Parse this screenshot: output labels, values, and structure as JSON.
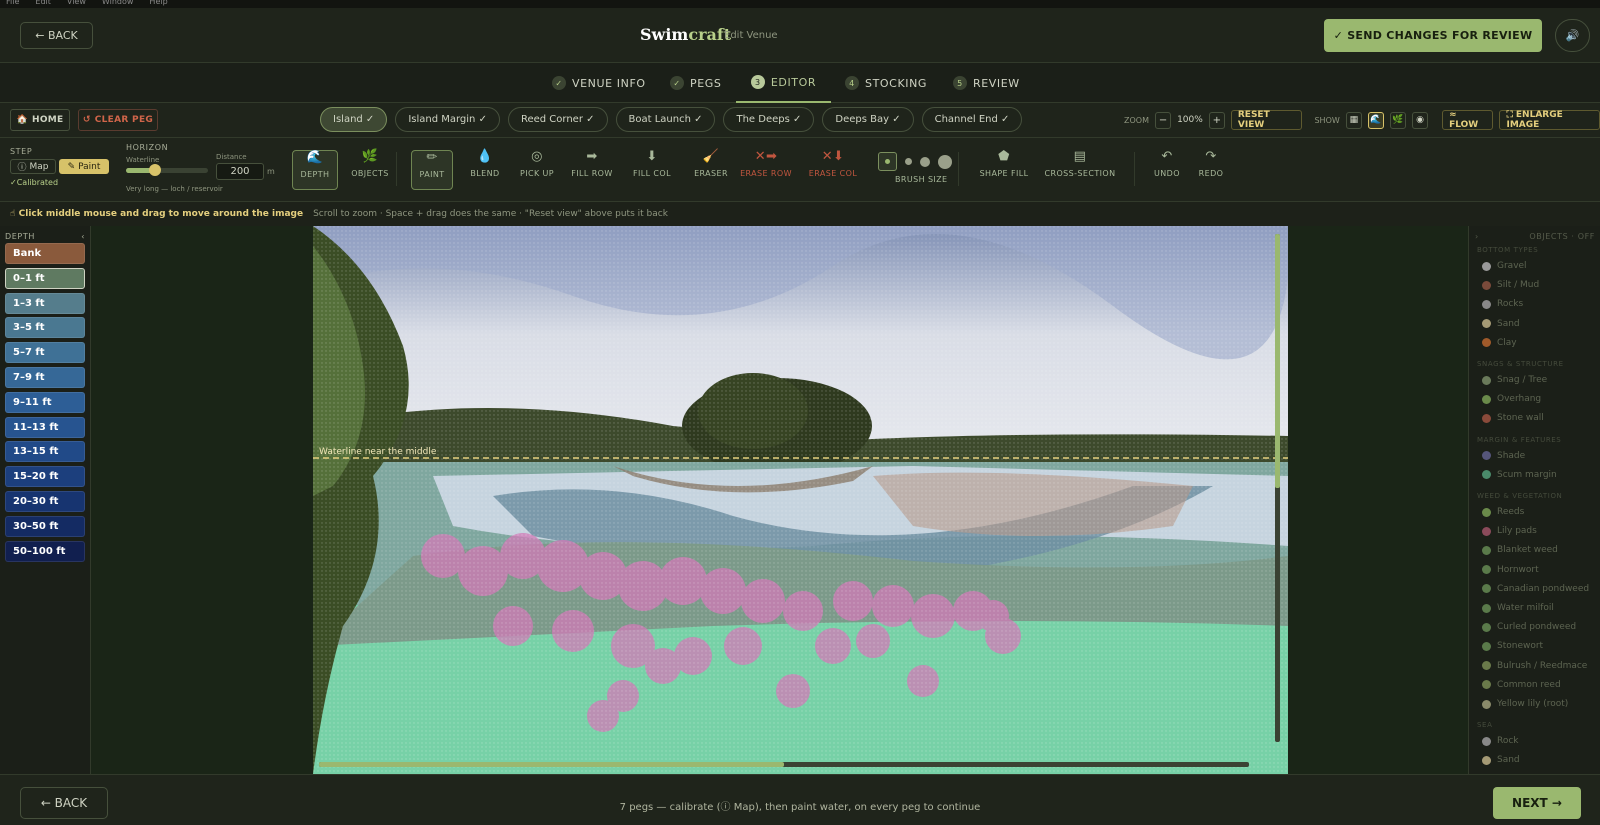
{
  "os_menu": [
    "File",
    "Edit",
    "View",
    "Window",
    "Help"
  ],
  "header": {
    "back_label": "← BACK",
    "brand_swim": "Swim",
    "brand_craft": "craft",
    "subtitle": "Edit Venue",
    "send_label": "✓ SEND CHANGES FOR REVIEW"
  },
  "steps": [
    {
      "num": "✓",
      "label": "VENUE INFO"
    },
    {
      "num": "✓",
      "label": "PEGS"
    },
    {
      "num": "3",
      "label": "EDITOR"
    },
    {
      "num": "4",
      "label": "STOCKING"
    },
    {
      "num": "5",
      "label": "REVIEW"
    }
  ],
  "pegbar": {
    "home_label": "HOME",
    "clear_label": "CLEAR PEG",
    "pegs": [
      "Island ✓",
      "Island Margin ✓",
      "Reed Corner ✓",
      "Boat Launch ✓",
      "The Deeps ✓",
      "Deeps Bay ✓",
      "Channel End ✓"
    ],
    "zoom_label": "ZOOM",
    "zoom_minus": "−",
    "zoom_value": "100%",
    "zoom_plus": "+",
    "reset_view": "RESET VIEW",
    "show_label": "SHOW",
    "flow_label": "≈ FLOW",
    "enlarge_label": "⛶ ENLARGE IMAGE"
  },
  "toolbar": {
    "step_label": "STEP",
    "map_label": "Map",
    "paint_label": "Paint",
    "calibrated": "✓Calibrated",
    "horizon_label": "HORIZON",
    "waterline_label": "Waterline",
    "distance_label": "Distance",
    "distance_value": "200",
    "distance_unit": "m",
    "waterline_level": 0.35,
    "horizon_note": "Very long — loch / reservoir",
    "tools": [
      {
        "icon": "🌊",
        "label": "DEPTH"
      },
      {
        "icon": "🌿",
        "label": "OBJECTS"
      },
      {
        "icon": "✏",
        "label": "PAINT"
      },
      {
        "icon": "💧",
        "label": "BLEND"
      },
      {
        "icon": "◎",
        "label": "PICK UP"
      },
      {
        "icon": "➡",
        "label": "FILL ROW"
      },
      {
        "icon": "⬇",
        "label": "FILL COL"
      },
      {
        "icon": "🧹",
        "label": "ERASER"
      },
      {
        "icon": "✕➡",
        "label": "ERASE ROW"
      },
      {
        "icon": "✕⬇",
        "label": "ERASE COL"
      },
      {
        "icon": "⬟",
        "label": "SHAPE FILL"
      },
      {
        "icon": "▤",
        "label": "CROSS-SECTION"
      },
      {
        "icon": "↶",
        "label": "UNDO"
      },
      {
        "icon": "↷",
        "label": "REDO"
      }
    ],
    "brush_label": "BRUSH SIZE"
  },
  "hint": {
    "main": "Click middle mouse and drag to move around the image",
    "sub": "Scroll to zoom · Space + drag does the same · \"Reset view\" above puts it back"
  },
  "depth": {
    "title": "DEPTH",
    "collapse": "‹",
    "items": [
      {
        "label": "Bank",
        "color": "#8a5a3c"
      },
      {
        "label": "0–1 ft",
        "color": "#5f7a61"
      },
      {
        "label": "1–3 ft",
        "color": "#557d8c"
      },
      {
        "label": "3–5 ft",
        "color": "#4a7891"
      },
      {
        "label": "5–7 ft",
        "color": "#3f7196"
      },
      {
        "label": "7–9 ft",
        "color": "#366897"
      },
      {
        "label": "9–11 ft",
        "color": "#2d5e96"
      },
      {
        "label": "11–13 ft",
        "color": "#275490"
      },
      {
        "label": "13–15 ft",
        "color": "#214a88"
      },
      {
        "label": "15–20 ft",
        "color": "#1c3f7d"
      },
      {
        "label": "20–30 ft",
        "color": "#173470"
      },
      {
        "label": "30–50 ft",
        "color": "#142b63"
      },
      {
        "label": "50–100 ft",
        "color": "#111f4f"
      }
    ]
  },
  "canvas": {
    "waterline_label": "Waterline near the middle",
    "vertical_scroll": 0.5,
    "horizontal_scroll": 0.5
  },
  "objects": {
    "title": "OBJECTS · OFF",
    "collapse": "›",
    "sections": [
      {
        "title": "BOTTOM TYPES",
        "items": [
          {
            "label": "Gravel",
            "color": "#999"
          },
          {
            "label": "Silt / Mud",
            "color": "#7a4a3a"
          },
          {
            "label": "Rocks",
            "color": "#888"
          },
          {
            "label": "Sand",
            "color": "#a59a75"
          },
          {
            "label": "Clay",
            "color": "#a05a2a"
          }
        ]
      },
      {
        "title": "SNAGS & STRUCTURE",
        "items": [
          {
            "label": "Snag / Tree",
            "color": "#6a7a5a"
          },
          {
            "label": "Overhang",
            "color": "#6a8a4a"
          },
          {
            "label": "Stone wall",
            "color": "#8a4a3a"
          }
        ]
      },
      {
        "title": "MARGIN & FEATURES",
        "items": [
          {
            "label": "Shade",
            "color": "#55557a"
          },
          {
            "label": "Scum margin",
            "color": "#4a8a6a"
          }
        ]
      },
      {
        "title": "WEED & VEGETATION",
        "items": [
          {
            "label": "Reeds",
            "color": "#6a8a4a"
          },
          {
            "label": "Lily pads",
            "color": "#8a4a5a"
          },
          {
            "label": "Blanket weed",
            "color": "#5a7a4a"
          },
          {
            "label": "Hornwort",
            "color": "#5a7a4a"
          },
          {
            "label": "Canadian pondweed",
            "color": "#5a7a4a"
          },
          {
            "label": "Water milfoil",
            "color": "#5a7a4a"
          },
          {
            "label": "Curled pondweed",
            "color": "#5a7a4a"
          },
          {
            "label": "Stonewort",
            "color": "#5a7a4a"
          },
          {
            "label": "Bulrush / Reedmace",
            "color": "#6a7a4a"
          },
          {
            "label": "Common reed",
            "color": "#6a7a4a"
          },
          {
            "label": "Yellow lily (root)",
            "color": "#8a8a6a"
          }
        ]
      },
      {
        "title": "SEA",
        "items": [
          {
            "label": "Rock",
            "color": "#888"
          },
          {
            "label": "Sand",
            "color": "#a59a75"
          }
        ]
      }
    ]
  },
  "footer": {
    "back_label": "← BACK",
    "message": "7 pegs — calibrate (ⓘ Map), then paint water, on every peg to continue",
    "next_label": "NEXT →"
  }
}
